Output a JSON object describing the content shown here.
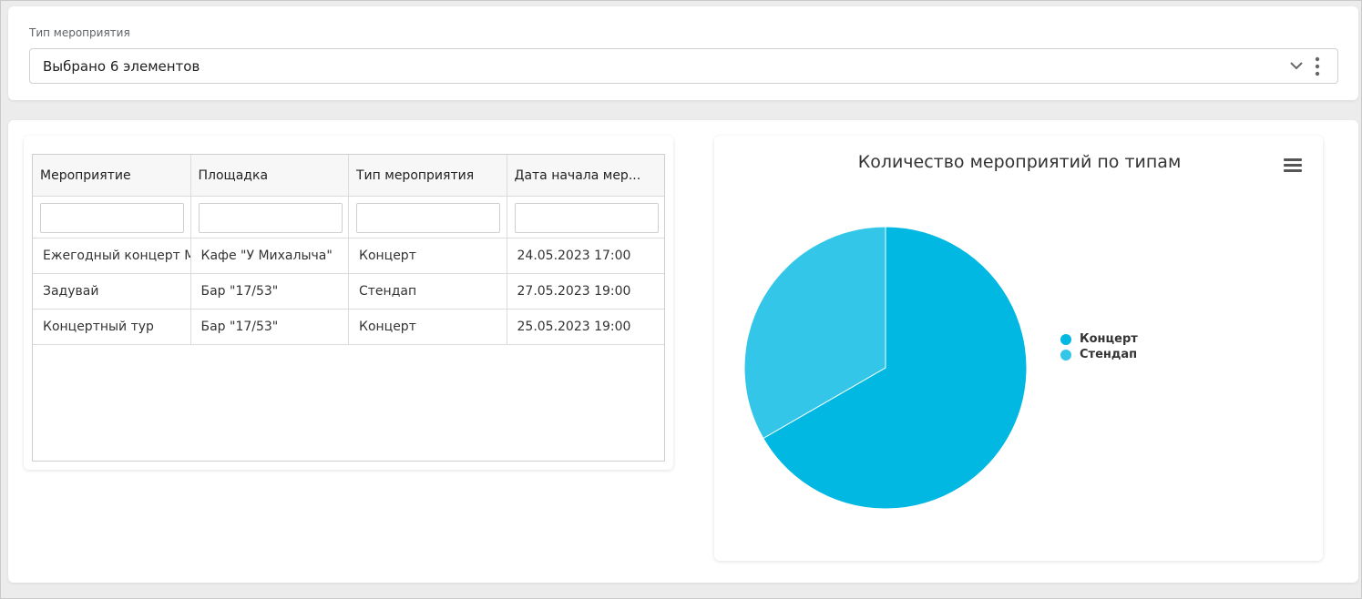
{
  "filter": {
    "label": "Тип мероприятия",
    "value": "Выбрано 6 элементов"
  },
  "table": {
    "columns": [
      "Мероприятие",
      "Площадка",
      "Тип мероприятия",
      "Дата начала мер..."
    ],
    "rows": [
      [
        "Ежегодный концерт Ми",
        "Кафе \"У Михалыча\"",
        "Концерт",
        "24.05.2023 17:00"
      ],
      [
        "Задувай",
        "Бар \"17/53\"",
        "Стендап",
        "27.05.2023 19:00"
      ],
      [
        "Концертный тур",
        "Бар \"17/53\"",
        "Концерт",
        "25.05.2023 19:00"
      ]
    ]
  },
  "chart_data": {
    "type": "pie",
    "title": "Количество мероприятий по типам",
    "categories": [
      "Концерт",
      "Стендап"
    ],
    "values": [
      2,
      1
    ],
    "colors": [
      "#00b8e2",
      "#33c6e8"
    ],
    "legend_position": "right"
  }
}
